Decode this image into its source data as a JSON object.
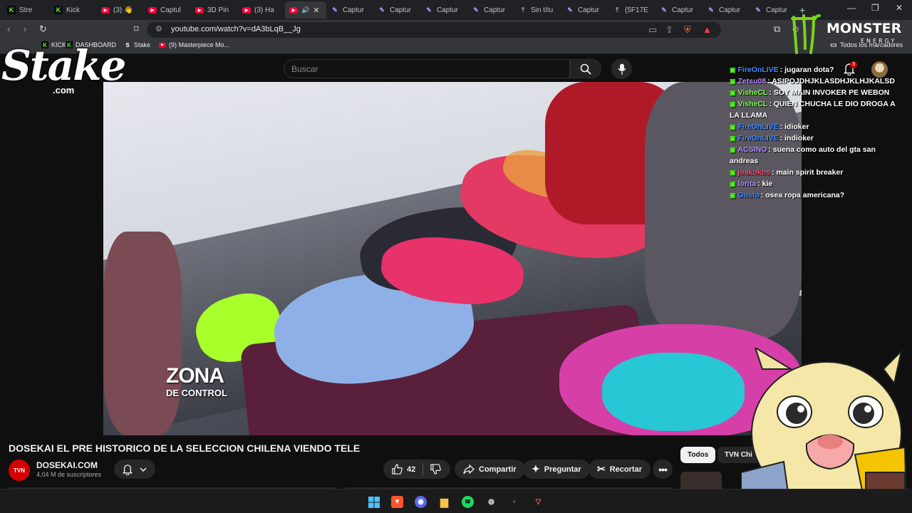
{
  "browser": {
    "tabs": [
      {
        "label": "Stre",
        "icon": "kick"
      },
      {
        "label": "Kick",
        "icon": "kick"
      },
      {
        "label": "(3) 👋",
        "icon": "youtube"
      },
      {
        "label": "Captul",
        "icon": "youtube"
      },
      {
        "label": "3D Pin",
        "icon": "youtube"
      },
      {
        "label": "(3) Ha",
        "icon": "youtube"
      },
      {
        "label": "",
        "icon": "youtube",
        "active": true
      },
      {
        "label": "Captur",
        "icon": "pen"
      },
      {
        "label": "Captur",
        "icon": "pen"
      },
      {
        "label": "Captur",
        "icon": "pen"
      },
      {
        "label": "Captur",
        "icon": "pen"
      },
      {
        "label": "Sin títu",
        "icon": "upload"
      },
      {
        "label": "Captur",
        "icon": "pen"
      },
      {
        "label": "{5F17E",
        "icon": "upload"
      },
      {
        "label": "Captur",
        "icon": "pen"
      },
      {
        "label": "Captur",
        "icon": "pen"
      },
      {
        "label": "Captur",
        "icon": "pen"
      }
    ],
    "url": "youtube.com/watch?v=dA3bLqB__Jg",
    "bookmarks": {
      "kick": "KICK",
      "dashboard": "DASHBOARD",
      "stake": "Stake",
      "masterpiece": "(9) Masterpiece Mo...",
      "all": "Todos los marcadores"
    }
  },
  "youtube": {
    "search_placeholder": "Buscar",
    "notification_count": "3",
    "video_title": "DOSEKAI EL PRE HISTORICO DE LA SELECCION CHILENA VIENDO TELE",
    "channel": {
      "name": "DOSEKAI.COM",
      "subscribers": "4,04 M de suscriptores",
      "avatar_text": "TVN"
    },
    "actions": {
      "likes": "42",
      "share": "Compartir",
      "ask": "Preguntar",
      "clip": "Recortar"
    },
    "chips": {
      "all": "Todos",
      "channel": "TVN Chi"
    },
    "overlay_text": {
      "line1": "ZONA",
      "line2": "DE CONTROL"
    }
  },
  "stake_logo": {
    "word": "Stake",
    "suffix": ".com"
  },
  "monster_logo": {
    "word": "MONSTER",
    "sub": "ENERGY"
  },
  "chat": [
    {
      "user": "FireOnLIVE",
      "color": "#3d8bff",
      "text": ": jugaran dota?"
    },
    {
      "user": "Zetsu08",
      "color": "#b38cff",
      "text": ": ASIPOJDHJKLASDHJKLHJKALSD"
    },
    {
      "user": "VisheCL",
      "color": "#7cff4d",
      "text": ": SOY MAIN INVOKER PE WEBON"
    },
    {
      "user": "VisheCL",
      "color": "#7cff4d",
      "text": ": QUIEN CHUCHA LE DIO DROGA A LA LLAMA"
    },
    {
      "user": "FireOnLIVE",
      "color": "#3d8bff",
      "text": ": idioker"
    },
    {
      "user": "FireOnLIVE",
      "color": "#3d8bff",
      "text": ": indioker"
    },
    {
      "user": "ACSINO",
      "color": "#b38cff",
      "text": ": suena como auto del gta san andreas"
    },
    {
      "user": "joakokos",
      "color": "#ff4d6d",
      "text": ": main spirit breaker"
    },
    {
      "user": "lorita",
      "color": "#b38cff",
      "text": ": kie"
    },
    {
      "user": "Gusto",
      "color": "#3d8bff",
      "text": ": osea ropa americana?"
    }
  ]
}
